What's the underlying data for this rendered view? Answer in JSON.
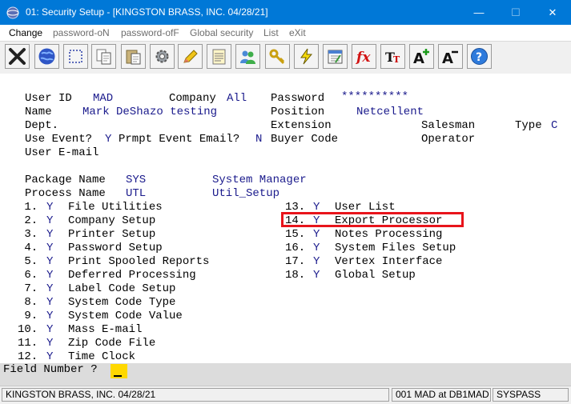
{
  "window": {
    "title": "01: Security Setup - [KINGSTON BRASS, INC. 04/28/21]",
    "minimize": "—",
    "maximize": "☐",
    "close": "✕"
  },
  "menu": {
    "change": "Change",
    "password_on": "password-oN",
    "password_off": "password-ofF",
    "global_security": "Global security",
    "list": "List",
    "exit": "eXit"
  },
  "toolbar": {
    "icons": [
      "close-icon",
      "globe-icon",
      "select-icon",
      "copy-icon",
      "paste-icon",
      "settings-icon",
      "edit-icon",
      "notes-icon",
      "users-icon",
      "key-icon",
      "lightning-icon",
      "calendar-icon",
      "function-icon",
      "font-icon",
      "increase-font-icon",
      "decrease-font-icon",
      "help-icon"
    ]
  },
  "form": {
    "user_id_label": "User ID",
    "user_id": "MAD",
    "company_label": "Company",
    "company": "All",
    "password_label": "Password",
    "password": "**********",
    "name_label": "Name",
    "name": "Mark DeShazo testing",
    "position_label": "Position",
    "position": "Netcellent",
    "dept_label": "Dept.",
    "extension_label": "Extension",
    "salesman_label": "Salesman",
    "type_label": "Type",
    "type": "C",
    "use_event_label": "Use Event?",
    "use_event": "Y",
    "prmpt_event_label": "Prmpt Event Email?",
    "prmpt_event": "N",
    "buyer_code_label": "Buyer Code",
    "operator_label": "Operator",
    "user_email_label": "User E-mail",
    "package_label": "Package Name",
    "package": "SYS",
    "package_desc": "System Manager",
    "process_label": "Process Name",
    "process": "UTL",
    "process_desc": "Util_Setup"
  },
  "items": [
    {
      "num": " 1.",
      "flag": "Y",
      "label": "File Utilities"
    },
    {
      "num": " 2.",
      "flag": "Y",
      "label": "Company Setup"
    },
    {
      "num": " 3.",
      "flag": "Y",
      "label": "Printer Setup"
    },
    {
      "num": " 4.",
      "flag": "Y",
      "label": "Password Setup"
    },
    {
      "num": " 5.",
      "flag": "Y",
      "label": "Print Spooled Reports"
    },
    {
      "num": " 6.",
      "flag": "Y",
      "label": "Deferred Processing"
    },
    {
      "num": " 7.",
      "flag": "Y",
      "label": "Label Code Setup"
    },
    {
      "num": " 8.",
      "flag": "Y",
      "label": "System Code Type"
    },
    {
      "num": " 9.",
      "flag": "Y",
      "label": "System Code Value"
    },
    {
      "num": "10.",
      "flag": "Y",
      "label": "Mass E-mail"
    },
    {
      "num": "11.",
      "flag": "Y",
      "label": "Zip Code File"
    },
    {
      "num": "12.",
      "flag": "Y",
      "label": "Time Clock"
    },
    {
      "num": "13.",
      "flag": "Y",
      "label": "User List"
    },
    {
      "num": "14.",
      "flag": "Y",
      "label": "Export Processor"
    },
    {
      "num": "15.",
      "flag": "Y",
      "label": "Notes Processing"
    },
    {
      "num": "16.",
      "flag": "Y",
      "label": "System Files Setup"
    },
    {
      "num": "17.",
      "flag": "Y",
      "label": "Vertex Interface"
    },
    {
      "num": "18.",
      "flag": "Y",
      "label": "Global Setup"
    }
  ],
  "field_prompt": "Field Number ?",
  "status": {
    "company": "KINGSTON BRASS, INC. 04/28/21",
    "session": "001 MAD at DB1MAD",
    "program": "SYSPASS"
  }
}
